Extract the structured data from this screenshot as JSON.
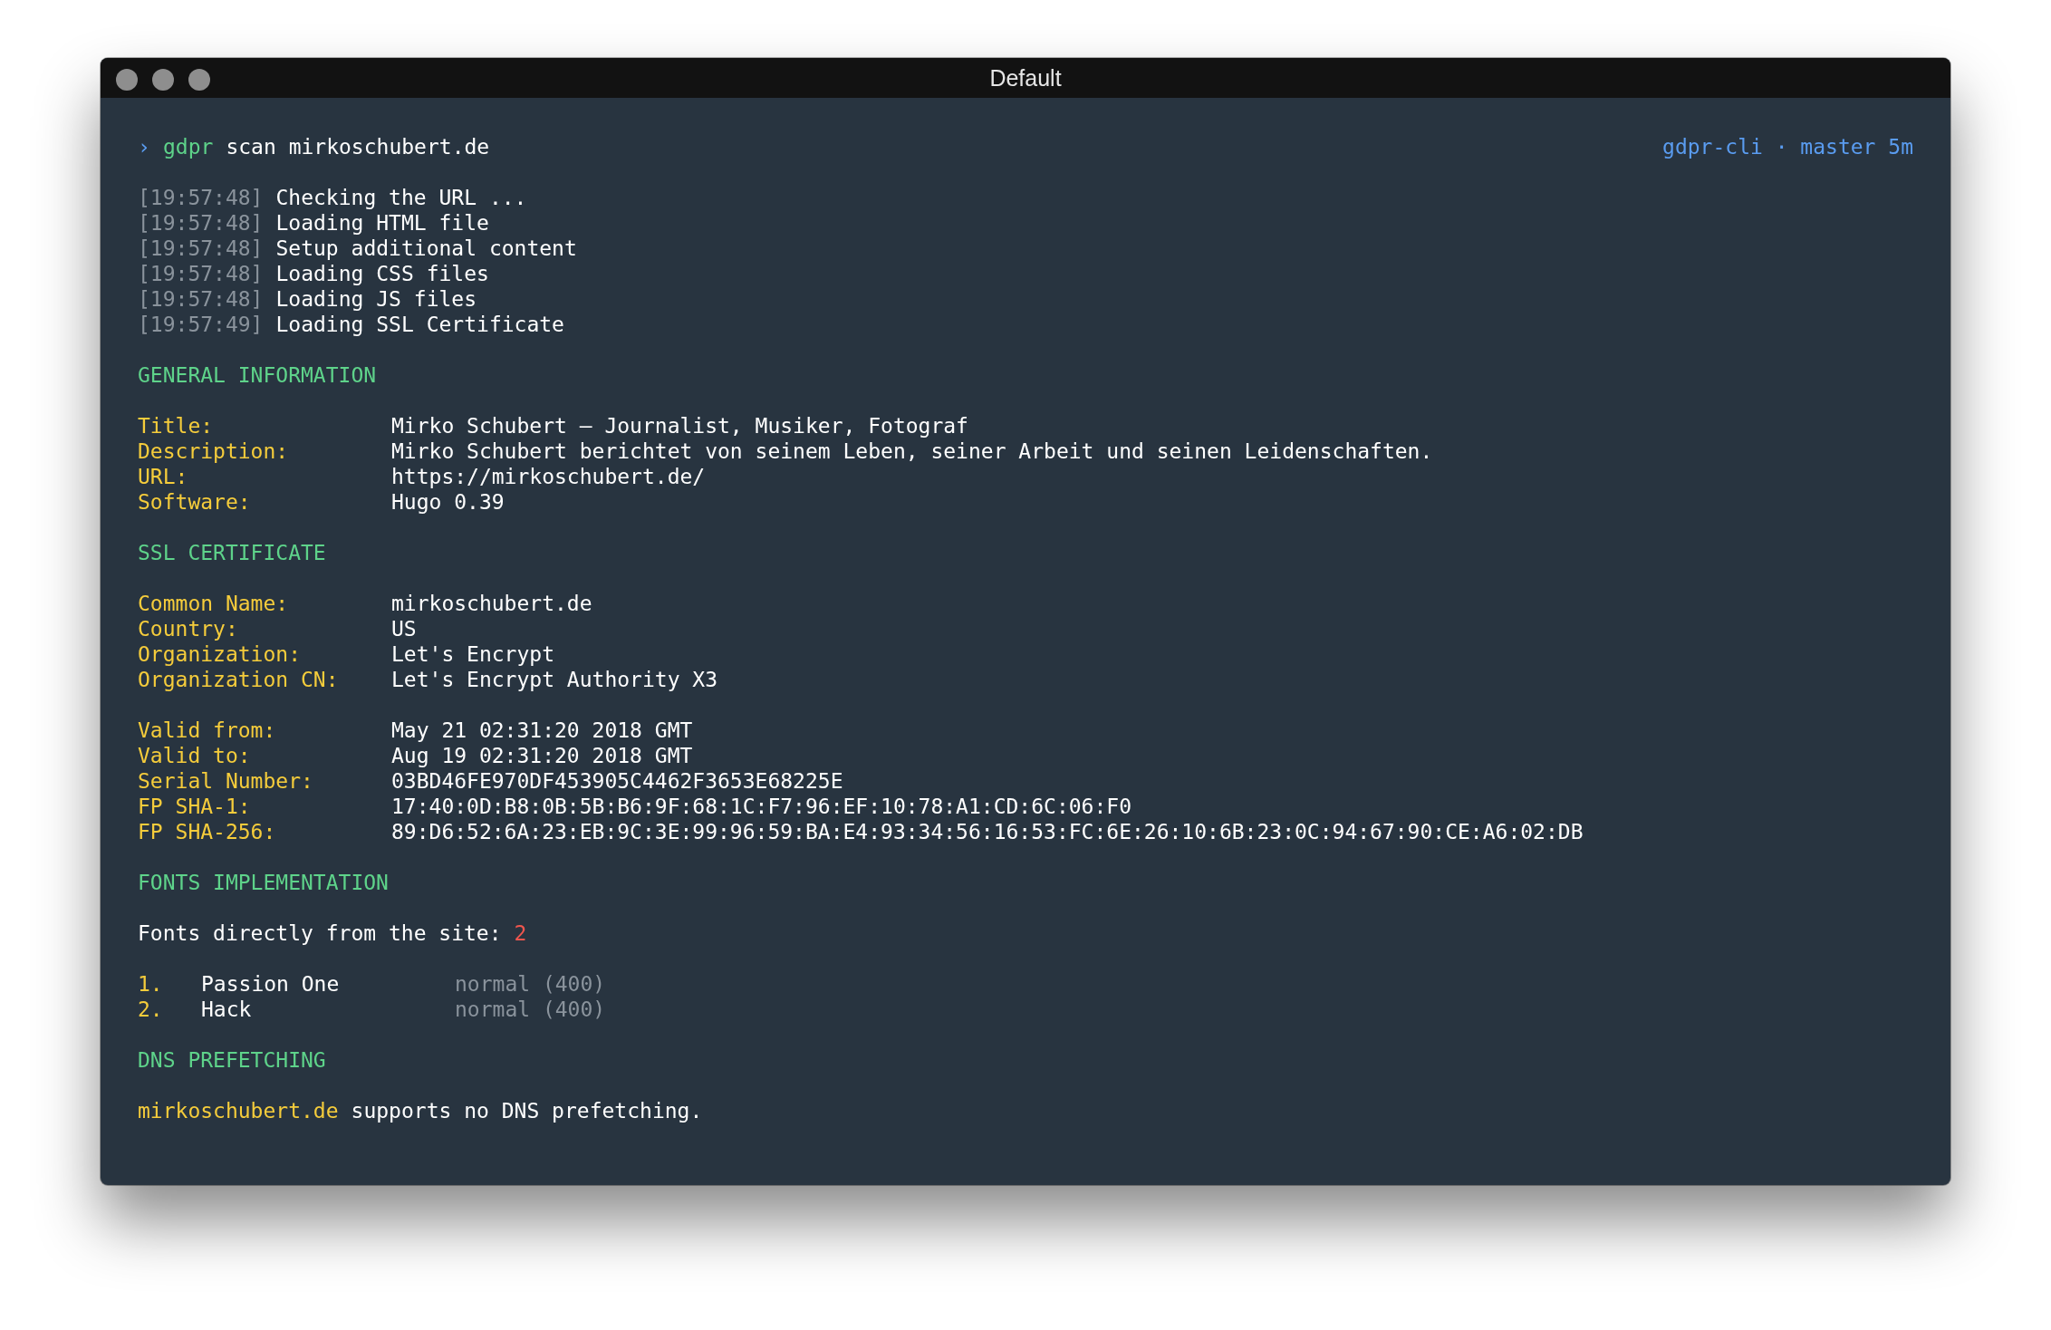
{
  "window": {
    "title": "Default"
  },
  "prompt": {
    "symbol": "›",
    "command": "gdpr",
    "args": "scan mirkoschubert.de",
    "status": "gdpr-cli · master 5m"
  },
  "log": [
    {
      "time": "[19:57:48]",
      "message": "Checking the URL ..."
    },
    {
      "time": "[19:57:48]",
      "message": "Loading HTML file"
    },
    {
      "time": "[19:57:48]",
      "message": "Setup additional content"
    },
    {
      "time": "[19:57:48]",
      "message": "Loading CSS files"
    },
    {
      "time": "[19:57:48]",
      "message": "Loading JS files"
    },
    {
      "time": "[19:57:49]",
      "message": "Loading SSL Certificate"
    }
  ],
  "sections": [
    {
      "kind": "fields",
      "heading": "GENERAL INFORMATION",
      "groups": [
        [
          {
            "label": "Title:",
            "value": "Mirko Schubert – Journalist, Musiker, Fotograf"
          },
          {
            "label": "Description:",
            "value": "Mirko Schubert berichtet von seinem Leben, seiner Arbeit und seinen Leidenschaften."
          },
          {
            "label": "URL:",
            "value": "https://mirkoschubert.de/"
          },
          {
            "label": "Software:",
            "value": "Hugo 0.39"
          }
        ]
      ]
    },
    {
      "kind": "fields",
      "heading": "SSL CERTIFICATE",
      "groups": [
        [
          {
            "label": "Common Name:",
            "value": "mirkoschubert.de"
          },
          {
            "label": "Country:",
            "value": "US"
          },
          {
            "label": "Organization:",
            "value": "Let's Encrypt"
          },
          {
            "label": "Organization CN:",
            "value": "Let's Encrypt Authority X3"
          }
        ],
        [
          {
            "label": "Valid from:",
            "value": "May 21 02:31:20 2018 GMT"
          },
          {
            "label": "Valid to:",
            "value": "Aug 19 02:31:20 2018 GMT"
          },
          {
            "label": "Serial Number:",
            "value": "03BD46FE970DF453905C4462F3653E68225E"
          },
          {
            "label": "FP SHA-1:",
            "value": "17:40:0D:B8:0B:5B:B6:9F:68:1C:F7:96:EF:10:78:A1:CD:6C:06:F0"
          },
          {
            "label": "FP SHA-256:",
            "value": "89:D6:52:6A:23:EB:9C:3E:99:96:59:BA:E4:93:34:56:16:53:FC:6E:26:10:6B:23:0C:94:67:90:CE:A6:02:DB"
          }
        ]
      ]
    },
    {
      "kind": "fonts",
      "heading": "FONTS IMPLEMENTATION",
      "summary": "Fonts directly from the site:",
      "count": "2",
      "items": [
        {
          "number": "1.",
          "name": "Passion One",
          "weight": "normal (400)"
        },
        {
          "number": "2.",
          "name": "Hack",
          "weight": "normal (400)"
        }
      ]
    },
    {
      "kind": "note",
      "heading": "DNS PREFETCHING",
      "domain": "mirkoschubert.de",
      "message": "supports no DNS prefetching."
    }
  ]
}
